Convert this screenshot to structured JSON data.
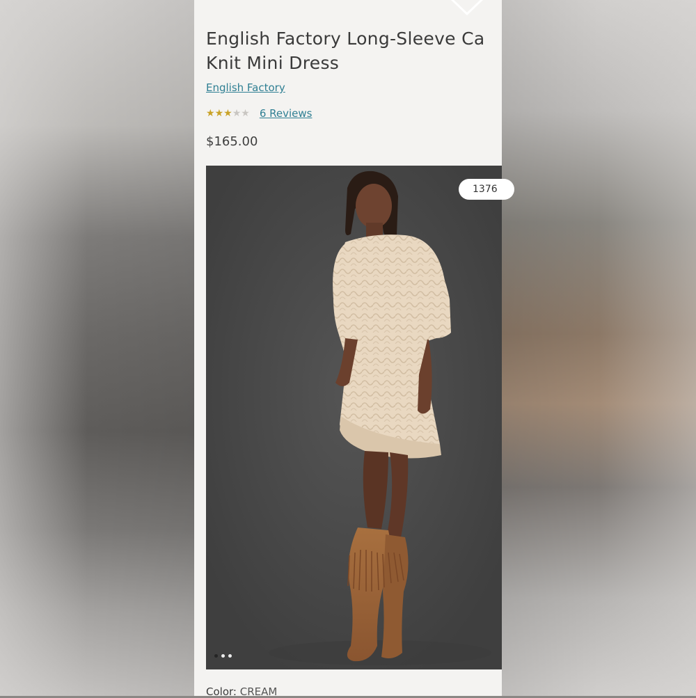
{
  "product": {
    "title_line1": "English Factory Long-Sleeve Ca",
    "title_line2": "Knit Mini Dress",
    "brand": "English Factory",
    "rating_stars": 3,
    "rating_max": 5,
    "reviews_label": "6 Reviews",
    "price": "$165.00",
    "color_label": "Color:",
    "color_value": "CREAM"
  },
  "gallery": {
    "counter_label": "1376",
    "dots": 3,
    "active_dot": 0
  },
  "icons": {
    "close": "close-icon",
    "star": "star-icon"
  },
  "colors": {
    "link": "#2f7f93",
    "star_on": "#c9a227",
    "star_off": "#c9c6c2",
    "photo_bg": "#4a4a4a",
    "sweater": "#e8d6bf",
    "boots": "#9a6134"
  }
}
